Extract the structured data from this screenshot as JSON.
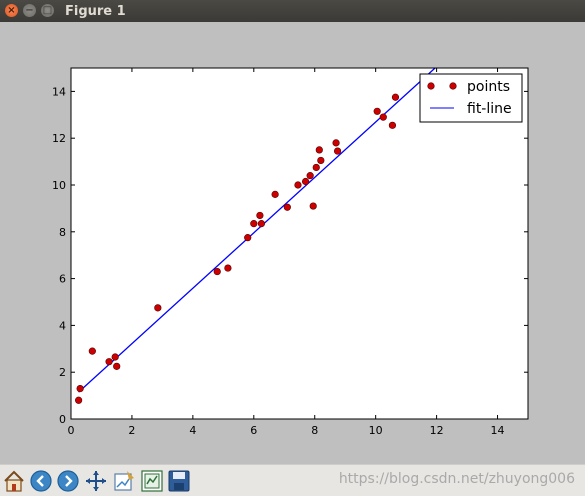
{
  "window": {
    "title": "Figure 1",
    "close_glyph": "×",
    "minimize_glyph": "−",
    "maximize_glyph": "□"
  },
  "chart_data": {
    "type": "scatter",
    "title": "",
    "xlabel": "",
    "ylabel": "",
    "xlim": [
      0,
      15
    ],
    "ylim": [
      0,
      15
    ],
    "xticks": [
      0,
      2,
      4,
      6,
      8,
      10,
      12,
      14
    ],
    "yticks": [
      0,
      2,
      4,
      6,
      8,
      10,
      12,
      14
    ],
    "grid": false,
    "legend_position": "top-right",
    "series": [
      {
        "name": "points",
        "kind": "scatter",
        "color": "#cc0000",
        "x": [
          0.25,
          0.3,
          0.7,
          1.25,
          1.45,
          1.5,
          2.85,
          4.8,
          5.15,
          5.8,
          6.0,
          6.2,
          6.25,
          6.7,
          7.1,
          7.45,
          7.7,
          7.85,
          7.95,
          8.05,
          8.15,
          8.2,
          8.7,
          8.75,
          10.05,
          10.25,
          10.55,
          10.65
        ],
        "y": [
          0.8,
          1.3,
          2.9,
          2.45,
          2.65,
          2.25,
          4.75,
          6.3,
          6.45,
          7.75,
          8.35,
          8.7,
          8.35,
          9.6,
          9.05,
          10.0,
          10.15,
          10.4,
          9.1,
          10.75,
          11.5,
          11.05,
          11.8,
          11.45,
          13.15,
          12.9,
          12.55,
          13.75
        ]
      },
      {
        "name": "fit-line",
        "kind": "line",
        "color": "#0000ff",
        "x": [
          0.25,
          11.95
        ],
        "y": [
          1.15,
          15.0
        ]
      }
    ]
  },
  "toolbar": {
    "tools": [
      {
        "name": "home-icon",
        "label": "Home"
      },
      {
        "name": "back-icon",
        "label": "Back"
      },
      {
        "name": "forward-icon",
        "label": "Forward"
      },
      {
        "name": "pan-icon",
        "label": "Pan"
      },
      {
        "name": "zoom-icon",
        "label": "Zoom"
      },
      {
        "name": "subplots-icon",
        "label": "Subplots"
      },
      {
        "name": "save-icon",
        "label": "Save"
      }
    ]
  },
  "watermark": "https://blog.csdn.net/zhuyong006"
}
